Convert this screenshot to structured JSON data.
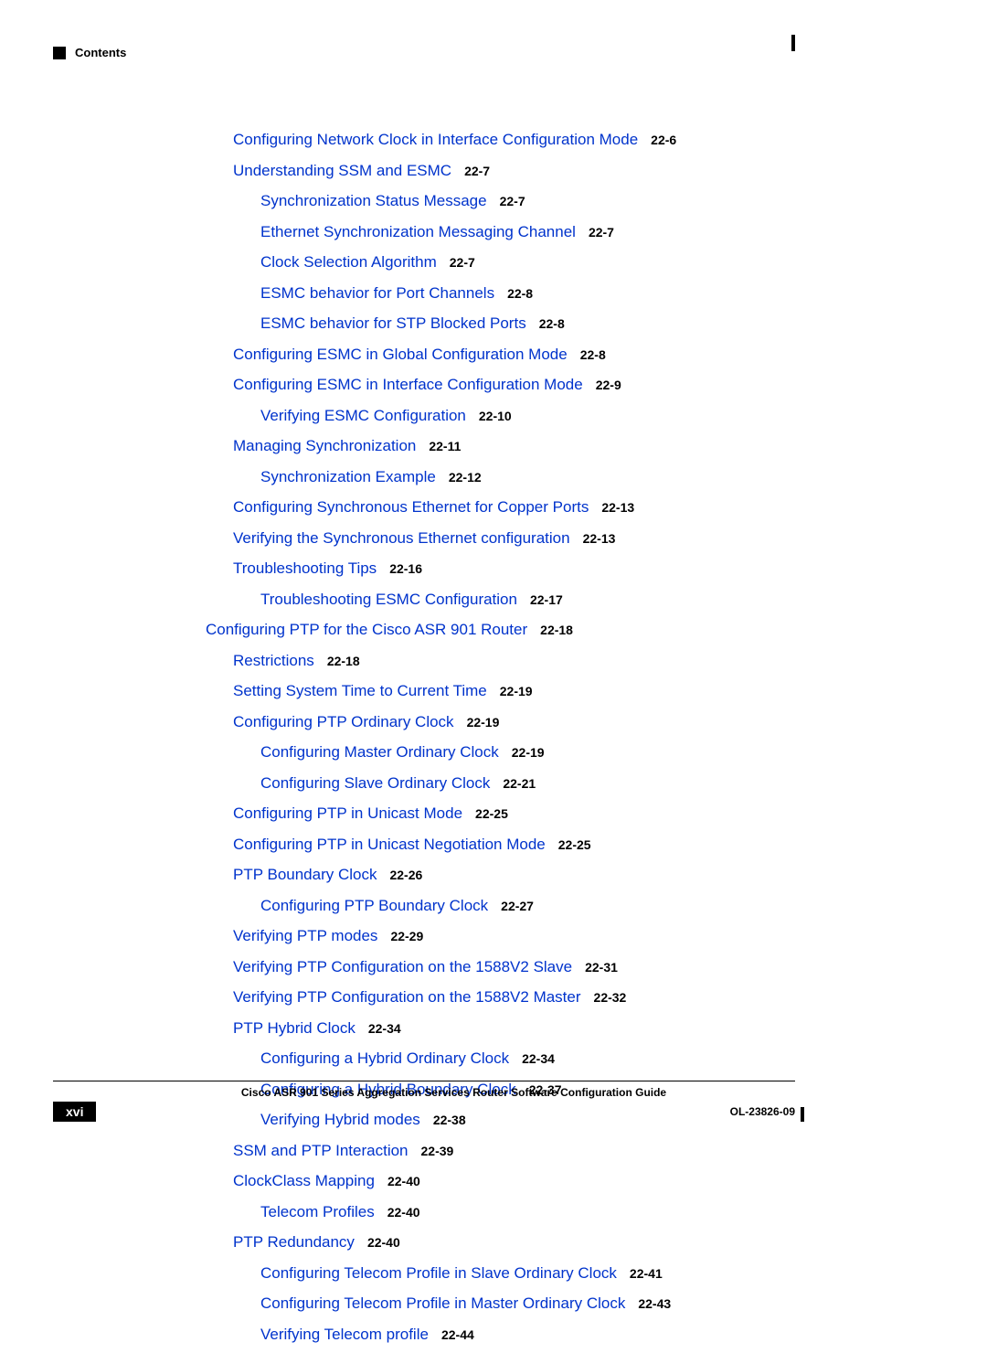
{
  "header": {
    "contents_label": "Contents"
  },
  "toc": [
    {
      "indent": 1,
      "label": "Configuring Network Clock in Interface Configuration Mode",
      "page": "22-6"
    },
    {
      "indent": 1,
      "label": "Understanding SSM and ESMC",
      "page": "22-7"
    },
    {
      "indent": 2,
      "label": "Synchronization Status Message",
      "page": "22-7"
    },
    {
      "indent": 2,
      "label": "Ethernet Synchronization Messaging Channel",
      "page": "22-7"
    },
    {
      "indent": 2,
      "label": "Clock Selection Algorithm",
      "page": "22-7"
    },
    {
      "indent": 2,
      "label": "ESMC behavior for Port Channels",
      "page": "22-8"
    },
    {
      "indent": 2,
      "label": "ESMC behavior for STP Blocked Ports",
      "page": "22-8"
    },
    {
      "indent": 1,
      "label": "Configuring ESMC in Global Configuration Mode",
      "page": "22-8"
    },
    {
      "indent": 1,
      "label": "Configuring ESMC in Interface Configuration Mode",
      "page": "22-9"
    },
    {
      "indent": 2,
      "label": "Verifying ESMC Configuration",
      "page": "22-10"
    },
    {
      "indent": 1,
      "label": "Managing Synchronization",
      "page": "22-11"
    },
    {
      "indent": 2,
      "label": "Synchronization Example",
      "page": "22-12"
    },
    {
      "indent": 1,
      "label": "Configuring Synchronous Ethernet for Copper Ports",
      "page": "22-13"
    },
    {
      "indent": 1,
      "label": "Verifying the Synchronous Ethernet configuration",
      "page": "22-13"
    },
    {
      "indent": 1,
      "label": "Troubleshooting Tips",
      "page": "22-16"
    },
    {
      "indent": 2,
      "label": "Troubleshooting ESMC Configuration",
      "page": "22-17"
    },
    {
      "indent": 0,
      "label": "Configuring PTP for the Cisco ASR 901 Router",
      "page": "22-18"
    },
    {
      "indent": 1,
      "label": "Restrictions",
      "page": "22-18"
    },
    {
      "indent": 1,
      "label": "Setting System Time to Current Time",
      "page": "22-19"
    },
    {
      "indent": 1,
      "label": "Configuring PTP Ordinary Clock",
      "page": "22-19"
    },
    {
      "indent": 2,
      "label": "Configuring Master Ordinary Clock",
      "page": "22-19"
    },
    {
      "indent": 2,
      "label": "Configuring Slave Ordinary Clock",
      "page": "22-21"
    },
    {
      "indent": 1,
      "label": "Configuring PTP in Unicast Mode",
      "page": "22-25"
    },
    {
      "indent": 1,
      "label": "Configuring PTP in Unicast Negotiation Mode",
      "page": "22-25"
    },
    {
      "indent": 1,
      "label": "PTP Boundary Clock",
      "page": "22-26"
    },
    {
      "indent": 2,
      "label": "Configuring PTP Boundary Clock",
      "page": "22-27"
    },
    {
      "indent": 1,
      "label": "Verifying PTP modes",
      "page": "22-29"
    },
    {
      "indent": 1,
      "label": "Verifying PTP Configuration on the 1588V2 Slave",
      "page": "22-31"
    },
    {
      "indent": 1,
      "label": "Verifying PTP Configuration on the 1588V2 Master",
      "page": "22-32"
    },
    {
      "indent": 1,
      "label": "PTP Hybrid Clock",
      "page": "22-34"
    },
    {
      "indent": 2,
      "label": "Configuring a Hybrid Ordinary Clock",
      "page": "22-34"
    },
    {
      "indent": 2,
      "label": "Configuring a Hybrid Boundary Clock",
      "page": "22-37"
    },
    {
      "indent": 2,
      "label": "Verifying Hybrid modes",
      "page": "22-38"
    },
    {
      "indent": 1,
      "label": "SSM and PTP Interaction",
      "page": "22-39"
    },
    {
      "indent": 1,
      "label": "ClockClass Mapping",
      "page": "22-40"
    },
    {
      "indent": 2,
      "label": "Telecom Profiles",
      "page": "22-40"
    },
    {
      "indent": 1,
      "label": "PTP Redundancy",
      "page": "22-40"
    },
    {
      "indent": 2,
      "label": "Configuring Telecom Profile in Slave Ordinary Clock",
      "page": "22-41"
    },
    {
      "indent": 2,
      "label": "Configuring Telecom Profile in Master Ordinary Clock",
      "page": "22-43"
    },
    {
      "indent": 2,
      "label": "Verifying Telecom profile",
      "page": "22-44"
    }
  ],
  "footer": {
    "title": "Cisco ASR 901 Series Aggregation Services Router Software Configuration Guide",
    "page_number": "xvi",
    "doc_ref": "OL-23826-09"
  }
}
